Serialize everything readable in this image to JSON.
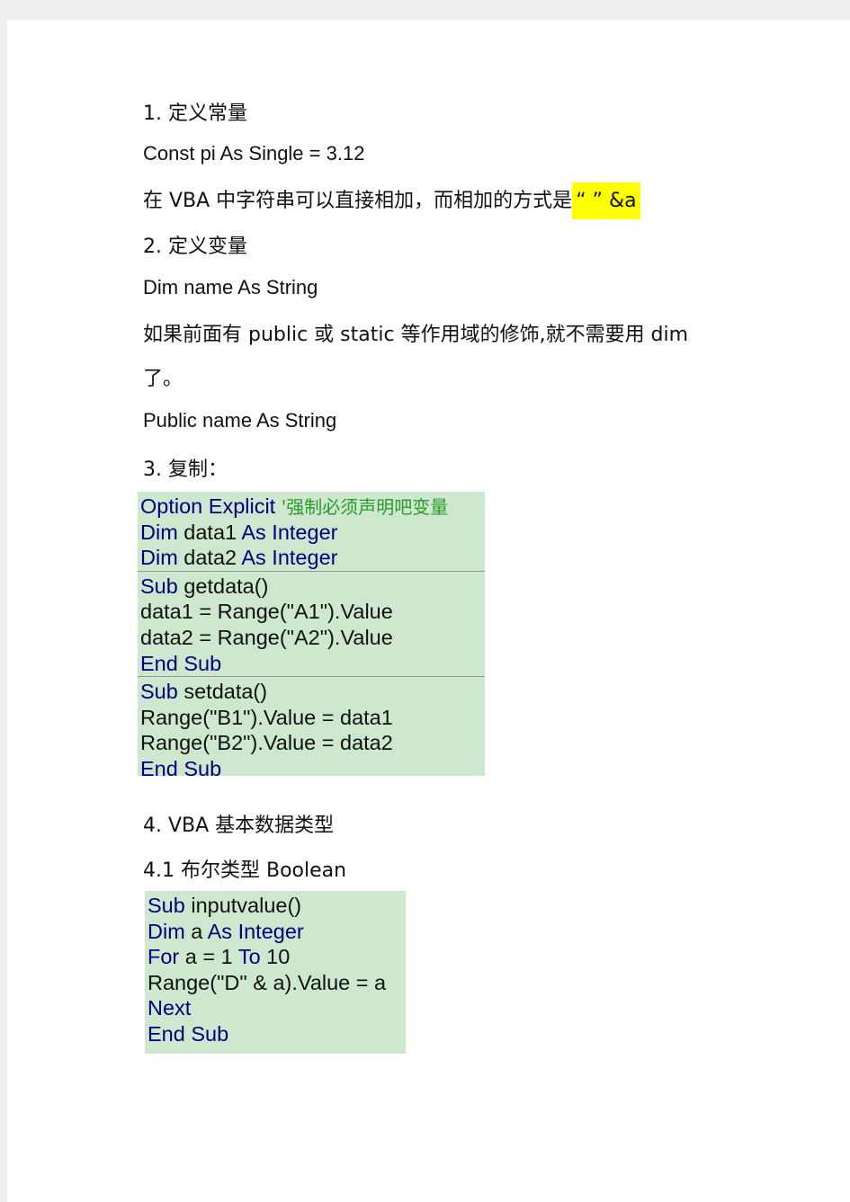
{
  "paragraphs": {
    "h1": "1. 定义常量",
    "const_line": "Const  pi  As  Single  =  3.12",
    "concat_note": "在 VBA 中字符串可以直接相加，而相加的方式是",
    "concat_highlight": "“ ” &a",
    "h2": "2. 定义变量",
    "dim_line": "Dim  name  As  String",
    "scope_note_1": "如果前面有 public 或 static 等作用域的修饰,就不需要用 dim",
    "scope_note_2": "了。",
    "public_line": "Public  name  As  String",
    "h3": "3. 复制：",
    "h4": "4. VBA 基本数据类型",
    "h4_1": "4.1 布尔类型  Boolean"
  },
  "colors": {
    "code_bg": "#cde8cf",
    "keyword": "#000080",
    "comment": "#2a9a2a",
    "highlight": "#ffff00"
  },
  "code_block_1": [
    [
      [
        {
          "t": "Option Explicit ",
          "c": "kw"
        },
        {
          "t": "'强制必须声明吧变量",
          "c": "cm"
        }
      ],
      [
        {
          "t": "Dim ",
          "c": "kw"
        },
        {
          "t": "data1 ",
          "c": "id"
        },
        {
          "t": "As Integer",
          "c": "kw"
        }
      ],
      [
        {
          "t": "Dim ",
          "c": "kw"
        },
        {
          "t": "data2 ",
          "c": "id"
        },
        {
          "t": "As Integer",
          "c": "kw"
        }
      ]
    ],
    [
      [
        {
          "t": "Sub ",
          "c": "kw"
        },
        {
          "t": "getdata()",
          "c": "id"
        }
      ],
      [
        {
          "t": "data1 = Range(\"A1\").Value",
          "c": "id"
        }
      ],
      [
        {
          "t": "data2 = Range(\"A2\").Value",
          "c": "id"
        }
      ],
      [
        {
          "t": "End Sub",
          "c": "kw"
        }
      ]
    ],
    [
      [
        {
          "t": "Sub ",
          "c": "kw"
        },
        {
          "t": "setdata()",
          "c": "id"
        }
      ],
      [
        {
          "t": "Range(\"B1\").Value = data1",
          "c": "id"
        }
      ],
      [
        {
          "t": "Range(\"B2\").Value = data2",
          "c": "id"
        }
      ],
      [
        {
          "t": "End Sub",
          "c": "kw"
        }
      ]
    ]
  ],
  "code_block_2": [
    [
      [
        {
          "t": "Sub ",
          "c": "kw"
        },
        {
          "t": "inputvalue()",
          "c": "id"
        }
      ],
      [
        {
          "t": "Dim ",
          "c": "kw"
        },
        {
          "t": "a ",
          "c": "id"
        },
        {
          "t": "As Integer",
          "c": "kw"
        }
      ],
      [
        {
          "t": "For ",
          "c": "kw"
        },
        {
          "t": "a = 1 ",
          "c": "id"
        },
        {
          "t": "To ",
          "c": "kw"
        },
        {
          "t": "10",
          "c": "id"
        }
      ],
      [
        {
          "t": "Range(\"D\" & a).Value = a",
          "c": "id"
        }
      ],
      [
        {
          "t": "Next",
          "c": "kw"
        }
      ],
      [
        {
          "t": "End Sub",
          "c": "kw"
        }
      ]
    ]
  ]
}
